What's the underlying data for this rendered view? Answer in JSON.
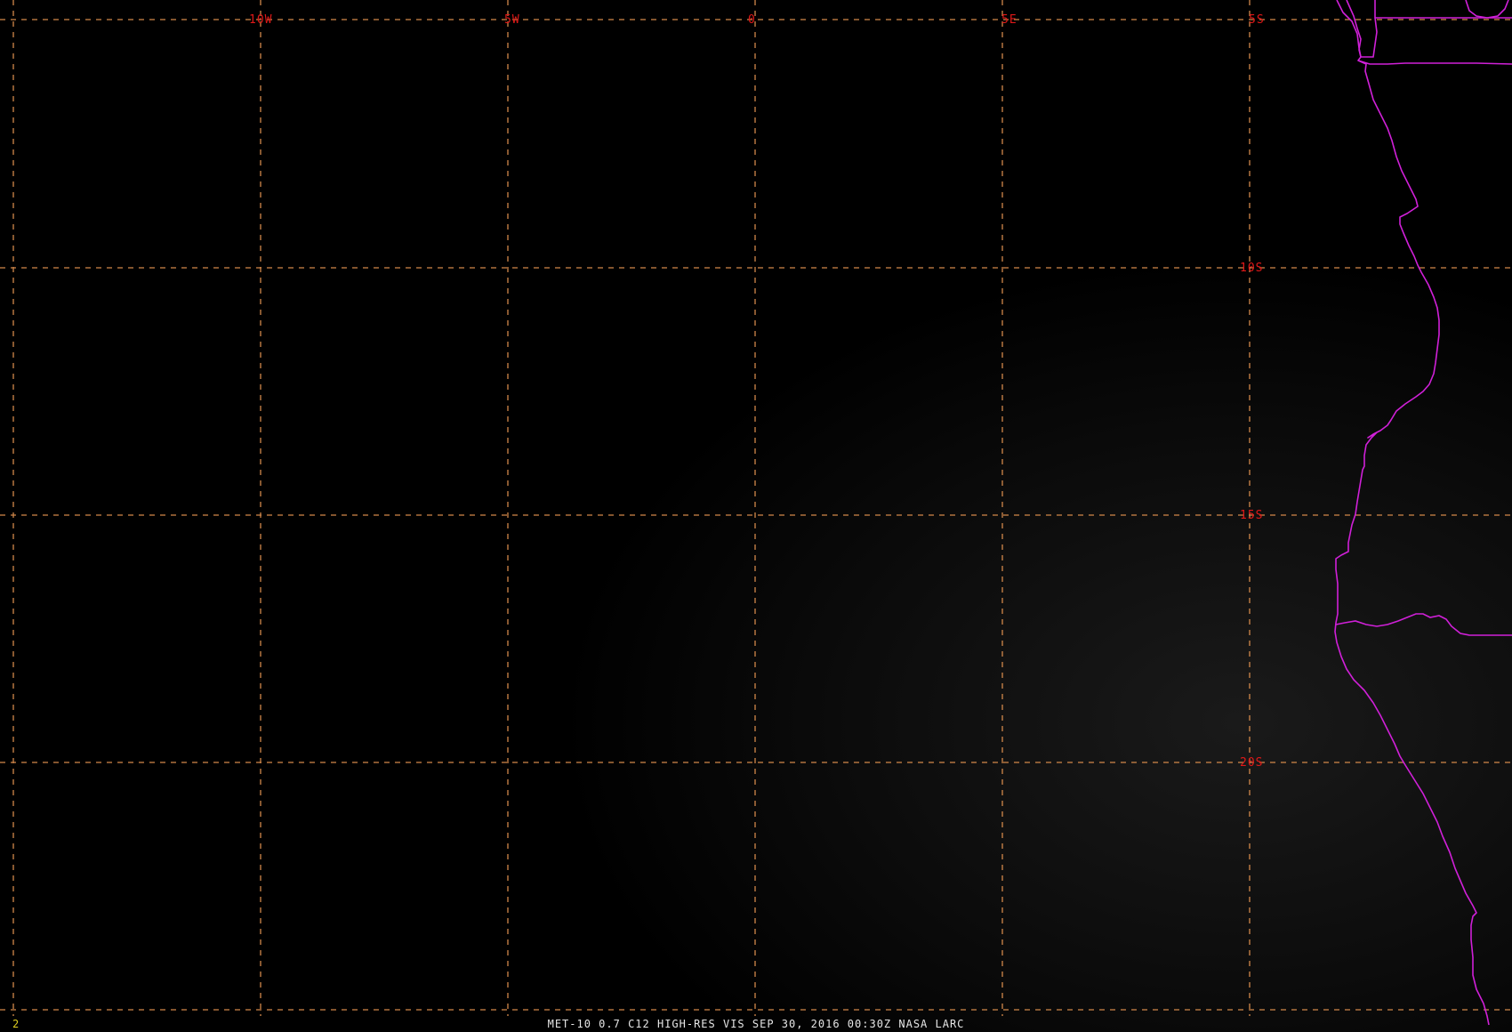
{
  "image": {
    "caption": "MET-10 0.7 C12 HIGH-RES VIS   SEP 30, 2016 00:30Z   NASA LARC",
    "frame_number": "2"
  },
  "grid": {
    "longitude_labels": [
      "10W",
      "5W",
      "0",
      "5E"
    ],
    "latitude_labels": [
      "5S",
      "10S",
      "15S",
      "20S"
    ]
  },
  "colors": {
    "background": "#000000",
    "gridline": "#d2884a",
    "grid_label": "#e01818",
    "coastline": "#d020d8",
    "caption_text": "#e6e6e6",
    "frame_number": "#e0d020"
  }
}
